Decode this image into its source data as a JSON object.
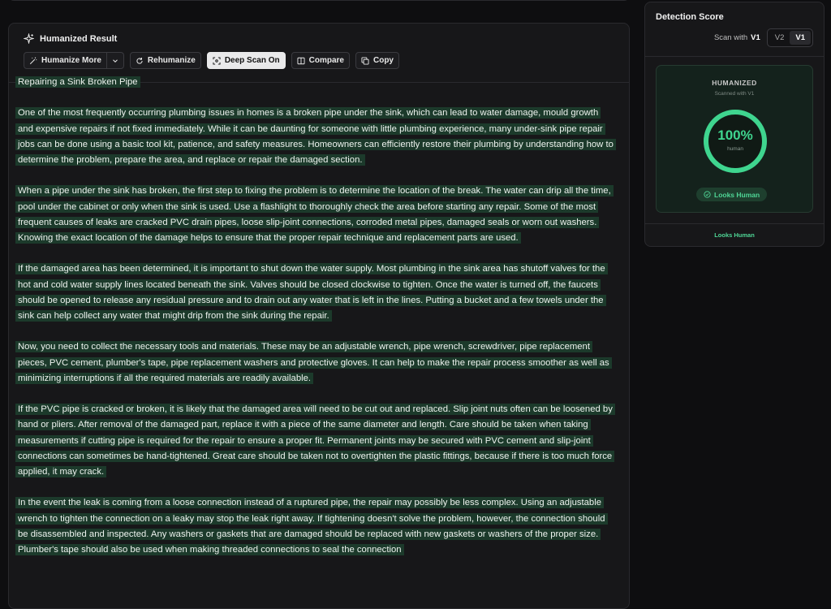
{
  "result_panel": {
    "title": "Humanized Result",
    "title_icon": "sparkles-icon",
    "toolbar": {
      "humanize_more": "Humanize More",
      "rehumanize": "Rehumanize",
      "deep_scan": "Deep Scan On",
      "compare": "Compare",
      "copy": "Copy"
    },
    "heading": "Repairing a Sink Broken Pipe",
    "paragraphs": [
      "One of the most frequently occurring plumbing issues in homes is a broken pipe under the sink, which can lead to water damage, mould growth and expensive repairs if not fixed immediately.  While it can be daunting for someone with little plumbing experience, many under-sink pipe repair jobs can be done using a basic tool kit, patience, and safety measures.  Homeowners can efficiently restore their plumbing by understanding how to determine the problem, prepare the area, and replace or repair the damaged section.",
      "When a pipe under the sink has broken, the first step to fixing the problem is to determine the location of the break.  The water can drip all the time, pool under the cabinet or only when the sink is used.  Use a flashlight to thoroughly check the area before starting any repair.  Some of the most frequent causes of leaks are cracked PVC drain pipes, loose slip-joint connections, corroded metal pipes, damaged seals or worn out washers.  Knowing the exact location of the damage helps to ensure that the proper repair technique and replacement parts are used.",
      "If the damaged area has been determined, it is important to shut down the water supply.  Most plumbing in the sink area has shutoff valves for the hot and cold water supply lines located beneath the sink.  Valves should be closed clockwise to tighten.  Once the water is turned off, the faucets should be opened to release any residual pressure and to drain out any water that is left in the lines.  Putting a bucket and a few towels under the sink can help collect any water that might drip from the sink during the repair.",
      "Now, you need to collect the necessary tools and materials.  These may be an adjustable wrench, pipe wrench, screwdriver, pipe replacement pieces, PVC cement, plumber's tape, pipe replacement washers and protective gloves.  It can help to make the repair process smoother as well as minimizing interruptions if all the required materials are readily available.",
      "If the PVC pipe is cracked or broken, it is likely that the damaged area will need to be cut out and replaced.  Slip joint nuts often can be loosened by hand or pliers.  After removal of the damaged part, replace it with a piece of the same diameter and length.  Care should be taken when taking measurements if cutting pipe is required for the repair to ensure a proper fit.  Permanent joints may be secured with PVC cement and slip-joint connections can sometimes be hand-tightened.  Great care should be taken not to overtighten the plastic fittings, because if there is too much force applied, it may crack.",
      "In the event the leak is coming from a loose connection instead of a ruptured pipe, the repair may possibly be less complex.  Using an adjustable wrench to tighten the connection on a leaky may stop the leak right away.  If tightening doesn't solve the problem, however, the connection should be disassembled and inspected.  Any washers or gaskets that are damaged should be replaced with new gaskets or washers of the proper size.  Plumber's tape should also be used when making threaded connections to seal the connection"
    ]
  },
  "detection": {
    "title": "Detection Score",
    "scan_with_label": "Scan with",
    "scan_version": "V1",
    "versions": [
      "V2",
      "V1"
    ],
    "selected_version": "V1",
    "card": {
      "label": "HUMANIZED",
      "sub": "Scanned with V1",
      "percent": "100%",
      "percent_value": 100,
      "unit": "human",
      "badge": "Looks Human"
    },
    "footer": "Looks Human"
  },
  "colors": {
    "accent": "#3fd58f",
    "highlight": "#1c3a2b",
    "panel": "#171719",
    "background": "#0e0e10"
  }
}
